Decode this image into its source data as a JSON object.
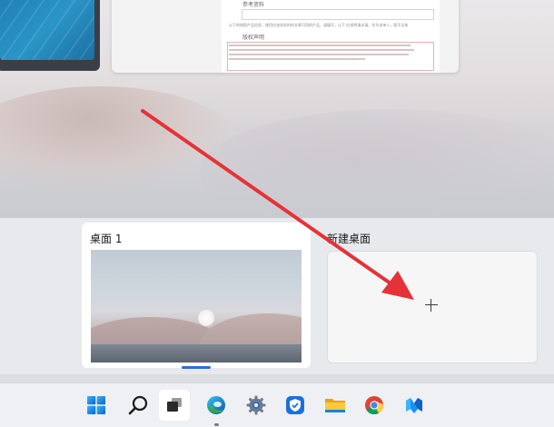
{
  "document_preview": {
    "section1_title": "参考资料",
    "section2_title": "版权声明",
    "note_text": "以下的按照产品信息，使用应该如实的的文章可用的产品，请填写，以下     应说明请本请，作为本单人，版不无效"
  },
  "desktops": [
    {
      "label": "桌面 1",
      "active": true
    },
    {
      "label": "新建桌面",
      "active": false
    }
  ],
  "taskbar": {
    "items": [
      {
        "name": "start",
        "icon": "windows-start-icon"
      },
      {
        "name": "search",
        "icon": "search-icon"
      },
      {
        "name": "task-view",
        "icon": "task-view-icon",
        "selected": true
      },
      {
        "name": "edge",
        "icon": "edge-icon",
        "running": true
      },
      {
        "name": "settings",
        "icon": "gear-icon"
      },
      {
        "name": "security",
        "icon": "shield-icon"
      },
      {
        "name": "file-explorer",
        "icon": "folder-icon"
      },
      {
        "name": "chrome",
        "icon": "chrome-icon"
      },
      {
        "name": "app",
        "icon": "app-logo-icon"
      }
    ]
  },
  "colors": {
    "arrow": "#e53238",
    "accent": "#2d6fd4"
  }
}
